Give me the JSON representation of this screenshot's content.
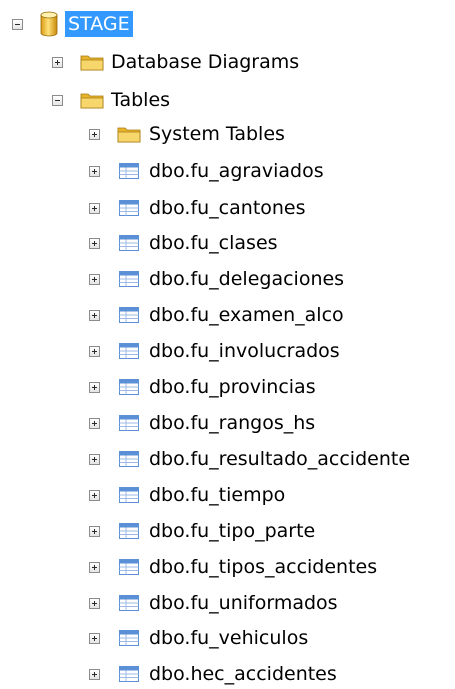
{
  "tree": {
    "server": {
      "label": "STAGE",
      "expanded": true,
      "selected": true,
      "icon": "database-cylinder-icon"
    },
    "database_diagrams": {
      "label": "Database Diagrams",
      "expanded": false,
      "icon": "folder-icon"
    },
    "tables": {
      "label": "Tables",
      "expanded": true,
      "icon": "folder-icon",
      "system_tables": {
        "label": "System Tables",
        "expanded": false,
        "icon": "folder-icon"
      },
      "items": [
        {
          "label": "dbo.fu_agraviados"
        },
        {
          "label": "dbo.fu_cantones"
        },
        {
          "label": "dbo.fu_clases"
        },
        {
          "label": "dbo.fu_delegaciones"
        },
        {
          "label": "dbo.fu_examen_alco"
        },
        {
          "label": "dbo.fu_involucrados"
        },
        {
          "label": "dbo.fu_provincias"
        },
        {
          "label": "dbo.fu_rangos_hs"
        },
        {
          "label": "dbo.fu_resultado_accidente"
        },
        {
          "label": "dbo.fu_tiempo"
        },
        {
          "label": "dbo.fu_tipo_parte"
        },
        {
          "label": "dbo.fu_tipos_accidentes"
        },
        {
          "label": "dbo.fu_uniformados"
        },
        {
          "label": "dbo.fu_vehiculos"
        },
        {
          "label": "dbo.hec_accidentes"
        }
      ]
    }
  },
  "colors": {
    "selection": "#3399ff",
    "folder": "#f2c94c",
    "table_icon": "#5b8fd6"
  }
}
